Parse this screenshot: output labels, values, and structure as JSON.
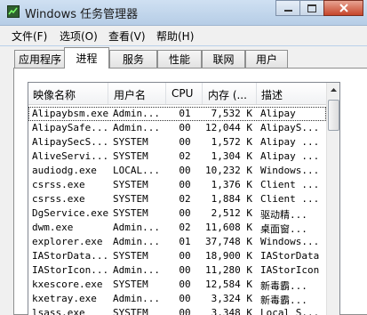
{
  "window": {
    "title": "Windows 任务管理器"
  },
  "menu": [
    "文件(F)",
    "选项(O)",
    "查看(V)",
    "帮助(H)"
  ],
  "tabs": [
    "应用程序",
    "进程",
    "服务",
    "性能",
    "联网",
    "用户"
  ],
  "active_tab": 1,
  "columns": [
    "映像名称",
    "用户名",
    "CPU",
    "内存 (...",
    "描述"
  ],
  "processes": [
    {
      "name": "Alipaybsm.exe",
      "user": "Admin...",
      "cpu": "01",
      "mem": "7,532 K",
      "desc": "Alipay"
    },
    {
      "name": "AlipaySafe...",
      "user": "Admin...",
      "cpu": "00",
      "mem": "12,044 K",
      "desc": "AlipayS..."
    },
    {
      "name": "AlipaySecS...",
      "user": "SYSTEM",
      "cpu": "00",
      "mem": "1,572 K",
      "desc": "Alipay ..."
    },
    {
      "name": "AliveServi...",
      "user": "SYSTEM",
      "cpu": "02",
      "mem": "1,304 K",
      "desc": "Alipay ..."
    },
    {
      "name": "audiodg.exe",
      "user": "LOCAL...",
      "cpu": "00",
      "mem": "10,232 K",
      "desc": "Windows..."
    },
    {
      "name": "csrss.exe",
      "user": "SYSTEM",
      "cpu": "00",
      "mem": "1,376 K",
      "desc": "Client ..."
    },
    {
      "name": "csrss.exe",
      "user": "SYSTEM",
      "cpu": "02",
      "mem": "1,884 K",
      "desc": "Client ..."
    },
    {
      "name": "DgService.exe",
      "user": "SYSTEM",
      "cpu": "00",
      "mem": "2,512 K",
      "desc": "驱动精..."
    },
    {
      "name": "dwm.exe",
      "user": "Admin...",
      "cpu": "02",
      "mem": "11,608 K",
      "desc": "桌面窗..."
    },
    {
      "name": "explorer.exe",
      "user": "Admin...",
      "cpu": "01",
      "mem": "37,748 K",
      "desc": "Windows..."
    },
    {
      "name": "IAStorData...",
      "user": "SYSTEM",
      "cpu": "00",
      "mem": "18,900 K",
      "desc": "IAStorData"
    },
    {
      "name": "IAStorIcon...",
      "user": "Admin...",
      "cpu": "00",
      "mem": "11,280 K",
      "desc": "IAStorIcon"
    },
    {
      "name": "kxescore.exe",
      "user": "SYSTEM",
      "cpu": "00",
      "mem": "12,584 K",
      "desc": "新毒霸..."
    },
    {
      "name": "kxetray.exe",
      "user": "Admin...",
      "cpu": "00",
      "mem": "3,324 K",
      "desc": "新毒霸..."
    },
    {
      "name": "lsass.exe",
      "user": "SYSTEM",
      "cpu": "00",
      "mem": "3,348 K",
      "desc": "Local S..."
    }
  ],
  "selected_row": 0,
  "colors": {
    "titlebar": "#b9d1ea",
    "close_button": "#c6452a"
  }
}
